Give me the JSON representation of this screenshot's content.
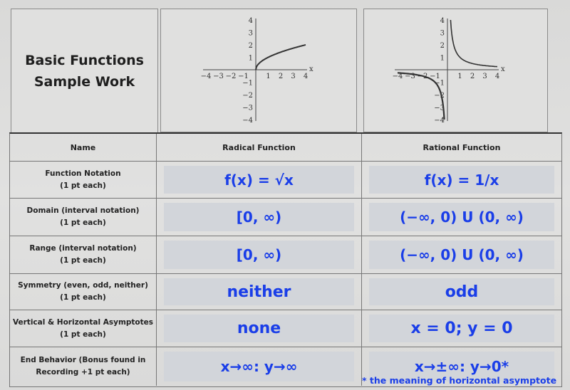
{
  "title": {
    "line1": "Basic Functions",
    "line2": "Sample Work"
  },
  "graphs": [
    {
      "name": "radical-graph",
      "function": "sqrt",
      "x_label": "x",
      "x_ticks": [
        "−4",
        "−3",
        "−2",
        "−1",
        "1",
        "2",
        "3",
        "4"
      ],
      "y_ticks": [
        "4",
        "3",
        "2",
        "1",
        "−1",
        "−2",
        "−3",
        "−4"
      ],
      "xlim": [
        -4,
        4
      ],
      "ylim": [
        -4,
        4
      ]
    },
    {
      "name": "rational-graph",
      "function": "reciprocal",
      "x_label": "x",
      "x_ticks": [
        "−4",
        "−3",
        "−2",
        "−1",
        "1",
        "2",
        "3",
        "4"
      ],
      "y_ticks": [
        "4",
        "3",
        "2",
        "1",
        "−1",
        "−2",
        "−3",
        "−4"
      ],
      "xlim": [
        -4,
        4
      ],
      "ylim": [
        -4,
        4
      ]
    }
  ],
  "table": {
    "header": {
      "name": "Name",
      "col1": "Radical Function",
      "col2": "Rational Function"
    },
    "rows": [
      {
        "label": "Function Notation",
        "sub": "(1 pt each)",
        "radical": "f(x) = √x",
        "rational": "f(x) = 1/x"
      },
      {
        "label": "Domain (interval notation)",
        "sub": "(1 pt each)",
        "radical": "[0, ∞)",
        "rational": "(−∞, 0) U (0, ∞)"
      },
      {
        "label": "Range (interval notation)",
        "sub": "(1 pt each)",
        "radical": "[0, ∞)",
        "rational": "(−∞, 0) U (0, ∞)"
      },
      {
        "label": "Symmetry (even, odd, neither)",
        "sub": "(1 pt each)",
        "radical": "neither",
        "rational": "odd"
      },
      {
        "label": "Vertical & Horizontal Asymptotes",
        "sub": "(1 pt each)",
        "radical": "none",
        "rational": "x = 0; y = 0"
      },
      {
        "label": "End Behavior (Bonus found in",
        "sub": "Recording +1 pt each)",
        "radical": "x→∞: y→∞",
        "rational": "x→±∞: y→0*"
      }
    ]
  },
  "footnote": "* the meaning of horizontal asymptote",
  "colors": {
    "answer_blue": "#1a3ee8",
    "answer_bg": "#d2d5da"
  }
}
